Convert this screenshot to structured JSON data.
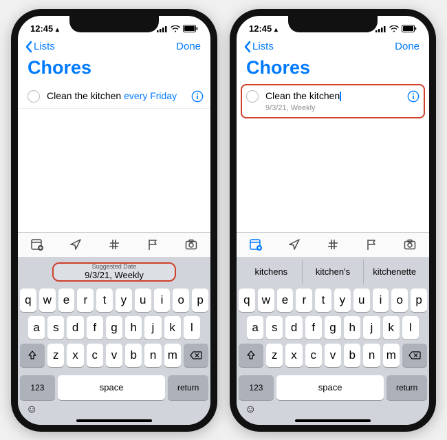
{
  "status": {
    "time": "12:45",
    "location_arrow": "➤"
  },
  "nav": {
    "back": "Lists",
    "done": "Done"
  },
  "title": "Chores",
  "left": {
    "reminder_text_a": "Clean the kitchen ",
    "reminder_text_b": "every Friday",
    "suggested_label": "Suggested Date",
    "suggested_value": "9/3/21, Weekly"
  },
  "right": {
    "reminder_text": "Clean the kitchen",
    "reminder_sub": "9/3/21, Weekly",
    "suggestions": [
      "kitchens",
      "kitchen's",
      "kitchenette"
    ]
  },
  "keyboard": {
    "row1": [
      "q",
      "w",
      "e",
      "r",
      "t",
      "y",
      "u",
      "i",
      "o",
      "p"
    ],
    "row2": [
      "a",
      "s",
      "d",
      "f",
      "g",
      "h",
      "j",
      "k",
      "l"
    ],
    "row3": [
      "z",
      "x",
      "c",
      "v",
      "b",
      "n",
      "m"
    ],
    "num": "123",
    "space": "space",
    "ret": "return"
  }
}
